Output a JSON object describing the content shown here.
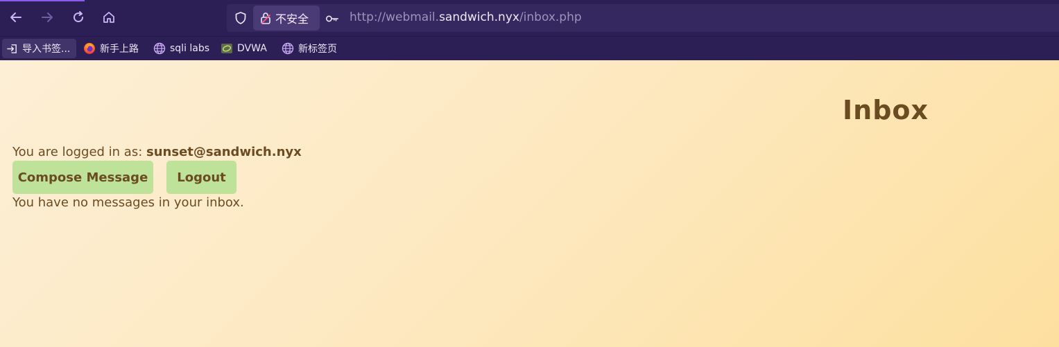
{
  "browser": {
    "security_label": "不安全",
    "url": {
      "prefix": "http://webmail.",
      "domain": "sandwich.nyx",
      "path": "/inbox.php"
    },
    "bookmarks": [
      {
        "label": "导入书签...",
        "icon": "import-icon"
      },
      {
        "label": "新手上路",
        "icon": "firefox-icon"
      },
      {
        "label": "sqli labs",
        "icon": "globe-icon"
      },
      {
        "label": "DVWA",
        "icon": "dvwa-icon"
      },
      {
        "label": "新标签页",
        "icon": "globe-icon"
      }
    ],
    "colors": {
      "toolbar_bg": "#2b1f55",
      "accent": "#8c5cf0"
    }
  },
  "page": {
    "title": "Inbox",
    "logged_in_prefix": "You are logged in as:",
    "logged_in_user": "sunset@sandwich.nyx",
    "compose_label": "Compose Message",
    "logout_label": "Logout",
    "empty_message": "You have no messages in your inbox.",
    "colors": {
      "text": "#6b4b22",
      "button_bg": "#bfe29b",
      "background_start": "#fdefd6",
      "background_end": "#fde0a0"
    }
  }
}
